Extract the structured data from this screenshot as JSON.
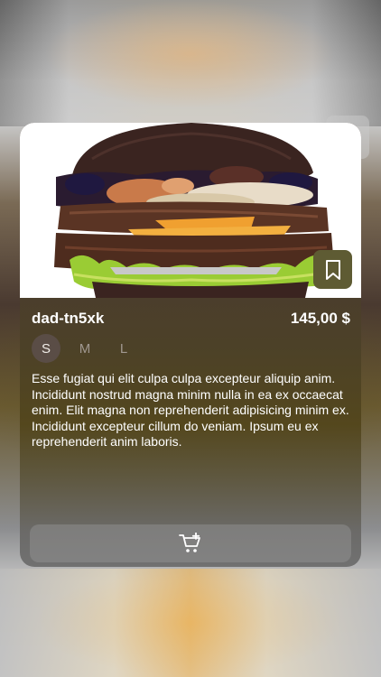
{
  "product": {
    "title": "dad-tn5xk",
    "price": "145,00 $",
    "description": "Esse fugiat qui elit culpa culpa excepteur aliquip anim. Incididunt nostrud magna minim nulla in ea ex occaecat enim. Elit magna non reprehenderit adipisicing minim ex. Incididunt excepteur cillum do veniam. Ipsum eu ex reprehenderit anim laboris.",
    "sizes": [
      {
        "label": "S",
        "selected": true
      },
      {
        "label": "M",
        "selected": false
      },
      {
        "label": "L",
        "selected": false
      }
    ]
  },
  "icons": {
    "close": "close-icon",
    "bookmark": "bookmark-icon",
    "cart": "cart-add-icon"
  },
  "colors": {
    "bookmark_bg": "#5e5b33",
    "text": "#ffffff"
  }
}
